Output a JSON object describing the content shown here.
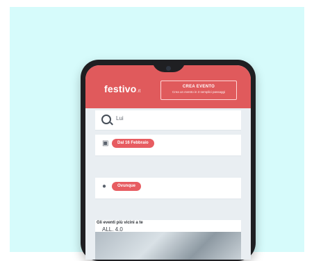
{
  "brand": {
    "logo_text": "festivo",
    "logo_suffix": ".it"
  },
  "header": {
    "cta_title": "CREA EVENTO",
    "cta_subtitle": "Crea un evento in 3 semplici passaggi"
  },
  "search": {
    "value": "Lui"
  },
  "filters": [
    {
      "icon": "calendar-icon",
      "label": "Dal 16 Febbraio"
    },
    {
      "icon": "location-icon",
      "label": "Ovunque"
    }
  ],
  "guests": {
    "label": "ALL. 4.0"
  },
  "section": {
    "title": "Gli eventi più vicini a te"
  },
  "colors": {
    "accent": "#e05a5c",
    "background": "#d6fbfb",
    "phone": "#1f1f22"
  }
}
